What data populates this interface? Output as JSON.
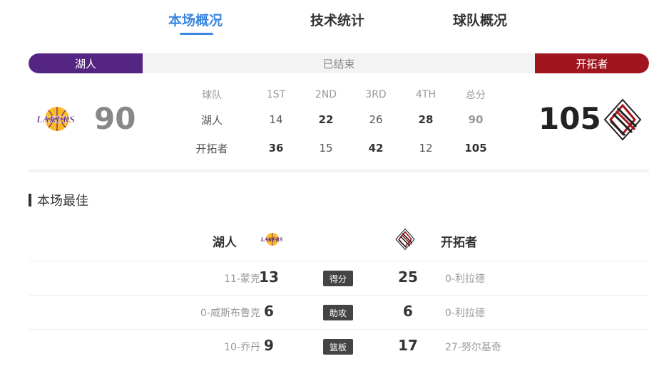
{
  "tabs": [
    {
      "label": "本场概况",
      "active": true
    },
    {
      "label": "技术统计",
      "active": false
    },
    {
      "label": "球队概况",
      "active": false
    }
  ],
  "status": {
    "home_team": "湖人",
    "away_team": "开拓者",
    "text": "已结束",
    "home_color": "#552583",
    "away_color": "#a0151e"
  },
  "score": {
    "home": "90",
    "away": "105",
    "home_logo": "lakers-logo-icon",
    "away_logo": "blazers-logo-icon"
  },
  "quarters": {
    "headers": [
      "球队",
      "1ST",
      "2ND",
      "3RD",
      "4TH",
      "总分"
    ],
    "rows": [
      {
        "team": "湖人",
        "q": [
          "14",
          "22",
          "26",
          "28"
        ],
        "total": "90"
      },
      {
        "team": "开拓者",
        "q": [
          "36",
          "15",
          "42",
          "12"
        ],
        "total": "105"
      }
    ]
  },
  "best": {
    "title": "本场最佳",
    "home_team": "湖人",
    "away_team": "开拓者",
    "rows": [
      {
        "home_player": "11-蒙克",
        "home_value": "13",
        "stat": "得分",
        "away_value": "25",
        "away_player": "0-利拉德"
      },
      {
        "home_player": "0-威斯布鲁克",
        "home_value": "6",
        "stat": "助攻",
        "away_value": "6",
        "away_player": "0-利拉德"
      },
      {
        "home_player": "10-乔丹",
        "home_value": "9",
        "stat": "篮板",
        "away_value": "17",
        "away_player": "27-努尔基奇"
      }
    ]
  },
  "colors": {
    "accent": "#3a86e0",
    "lakers_purple": "#552583",
    "lakers_gold": "#fdb927",
    "blazers_red": "#a0151e"
  }
}
